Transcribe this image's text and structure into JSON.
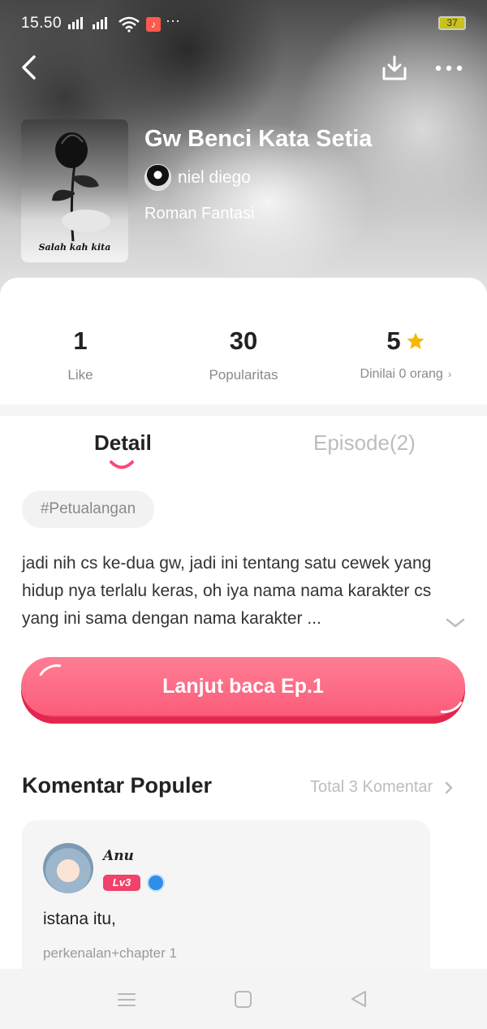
{
  "status_bar": {
    "time": "15.50",
    "battery": "37",
    "colors": {
      "music_badge": "#ff5a4e",
      "battery": "#c9c21a"
    }
  },
  "header": {
    "icons": [
      "back-icon",
      "download-icon",
      "more-icon"
    ]
  },
  "book": {
    "title": "Gw Benci Kata Setia",
    "author": "niel diego",
    "genre": "Roman Fantasi",
    "cover_caption": "Salah kah kita"
  },
  "stats": {
    "like_value": "1",
    "like_label": "Like",
    "popularity_value": "30",
    "popularity_label": "Popularitas",
    "rating_value": "5",
    "rating_label": "Dinilai 0 orang"
  },
  "tabs": {
    "detail": "Detail",
    "episode": "Episode(2)"
  },
  "tag": "#Petualangan",
  "synopsis": "jadi nih cs ke-dua gw, jadi ini tentang satu cewek yang hidup nya terlalu keras, oh iya nama nama karakter cs yang ini sama dengan nama karakter ...",
  "read_button": "Lanjut baca Ep.1",
  "comments_section": {
    "title": "Komentar Populer",
    "total": "Total 3 Komentar",
    "items": [
      {
        "name": "Anu",
        "level": "Lv3",
        "text": "istana itu,",
        "chapter": "perkenalan+chapter 1"
      }
    ]
  },
  "colors": {
    "accent": "#fb5d7a",
    "star": "#f5b800",
    "muted": "#8a8a8a"
  }
}
